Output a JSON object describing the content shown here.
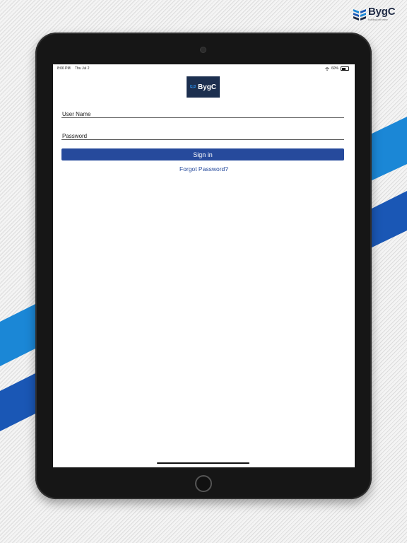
{
  "brand": {
    "name": "BygC",
    "tagline": "building with ease",
    "mark_icon": "bygc-logo-icon",
    "colors": {
      "navy": "#1f2a44",
      "blue": "#1a5fb4",
      "light_blue": "#1b87d6"
    }
  },
  "status_bar": {
    "time": "8:06 PM",
    "date": "Thu Jul 2",
    "battery_percent": "60%",
    "battery_level": 0.6,
    "icons": [
      "wifi-icon",
      "battery-icon"
    ]
  },
  "app": {
    "logo_text": "BygC",
    "username": {
      "label": "User Name",
      "value": ""
    },
    "password": {
      "label": "Password",
      "value": ""
    },
    "sign_in_label": "Sign in",
    "forgot_password_label": "Forgot Password?",
    "accent_color": "#264a9c"
  }
}
